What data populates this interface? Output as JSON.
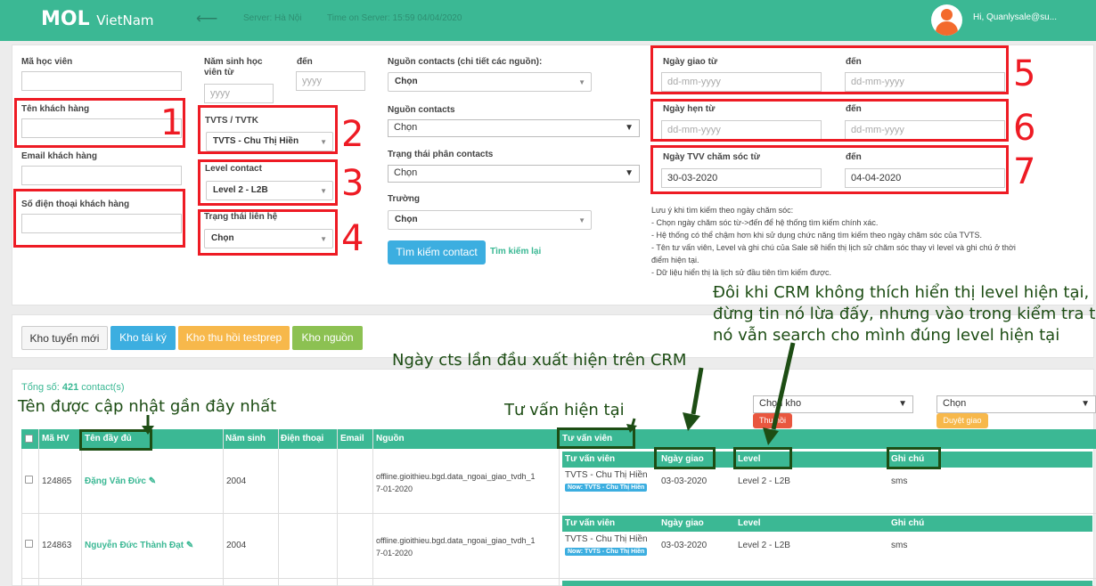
{
  "header": {
    "logo_main": "MOL",
    "logo_sub": "VietNam",
    "back_glyph": "⟵",
    "server": "Server: Hà Nội",
    "time": "Time on Server: 15:59 04/04/2020",
    "user": "Hi, Quanlysale@su..."
  },
  "filters": {
    "ma_hoc_vien": "Mã học viên",
    "ten_khach_hang": "Tên khách hàng",
    "email_khach_hang": "Email khách hàng",
    "so_dien_thoai": "Số điện thoại khách hàng",
    "nam_sinh_tu_line1": "Năm sinh học",
    "nam_sinh_tu_line2": "viên từ",
    "nam_sinh_den": "đến",
    "yyyy": "yyyy",
    "tvts_label": "TVTS / TVTK",
    "tvts_value": "TVTS - Chu Thị Hiền",
    "level_label": "Level contact",
    "level_value": "Level 2 - L2B",
    "trang_thai_lien_he": "Trạng thái liên hệ",
    "chon": "Chọn",
    "nguon_chi_tiet": "Nguồn contacts (chi tiết các nguồn):",
    "nguon_contacts": "Nguồn contacts",
    "trang_thai_phan": "Trạng thái phân contacts",
    "truong": "Trường",
    "search_button": "Tìm kiếm contact",
    "reset_link": "Tìm kiếm lại",
    "ngay_giao_tu": "Ngày giao từ",
    "ngay_hen_tu": "Ngày hẹn từ",
    "ngay_tvv_tu": "Ngày TVV chăm sóc từ",
    "den": "đến",
    "date_placeholder": "dd-mm-yyyy",
    "tvv_from": "30-03-2020",
    "tvv_to": "04-04-2020"
  },
  "notes": [
    "Lưu ý khi tìm kiếm theo ngày chăm sóc:",
    "- Chọn ngày chăm sóc từ->đến để hệ thống tìm kiếm chính xác.",
    "- Hệ thống có thể chậm hơn khi sử dụng chức năng tìm kiếm theo ngày chăm sóc của TVTS.",
    "- Tên tư vấn viên, Level và ghi chú của Sale sẽ hiển thị lịch sử chăm sóc thay vì level và ghi chú ở thời điểm hiện tại.",
    "- Dữ liệu hiển thị là lịch sử đầu tiên tìm kiếm được."
  ],
  "tabs": {
    "kho_tuyen_moi": "Kho tuyển mới",
    "kho_tai_ky": "Kho tái ký",
    "kho_thu_hoi": "Kho thu hồi testprep",
    "kho_nguon": "Kho nguồn"
  },
  "results": {
    "total_label": "Tổng số:",
    "total_count": "421",
    "total_unit": "contact(s)",
    "chon_kho": "Chọn kho",
    "chon": "Chọn",
    "thu_hoi": "Thu hồi",
    "duyet_giao": "Duyệt giao"
  },
  "table": {
    "headers": {
      "ma_hv": "Mã HV",
      "ten_day_du": "Tên đầy đủ",
      "nam_sinh": "Năm sinh",
      "dien_thoai": "Điện thoại",
      "email": "Email",
      "nguon": "Nguồn",
      "tu_van_vien": "Tư vấn viên"
    },
    "sub_headers": {
      "tu_van_vien": "Tư vấn viên",
      "ngay_giao": "Ngày giao",
      "level": "Level",
      "ghi_chu": "Ghi chú"
    },
    "rows": [
      {
        "ma_hv": "124865",
        "ten": "Đặng Văn Đức",
        "nam_sinh": "2004",
        "nguon_1": "offline.gioithieu.bgd.data_ngoai_giao_tvdh_1",
        "nguon_2": "7-01-2020",
        "tvv": "TVTS - Chu Thị Hiền",
        "now": "Now: TVTS - Chu Thị Hiền",
        "ngay_giao": "03-03-2020",
        "level": "Level 2 - L2B",
        "ghi_chu": "sms"
      },
      {
        "ma_hv": "124863",
        "ten": "Nguyễn Đức Thành Đạt",
        "nam_sinh": "2004",
        "nguon_1": "offline.gioithieu.bgd.data_ngoai_giao_tvdh_1",
        "nguon_2": "7-01-2020",
        "tvv": "TVTS - Chu Thị Hiền",
        "now": "Now: TVTS - Chu Thị Hiền",
        "ngay_giao": "03-03-2020",
        "level": "Level 2 - L2B",
        "ghi_chu": "sms"
      }
    ]
  },
  "annotations": {
    "numbers": [
      "1",
      "2",
      "3",
      "4",
      "5",
      "6",
      "7"
    ],
    "crm_line1": "Đôi khi CRM không thích hiển thị level hiện tại,",
    "crm_line2": "đừng tin nó lừa đấy, nhưng vào trong kiểm tra thì",
    "crm_line3": "nó vẫn search cho mình đúng level hiện tại",
    "ngay_cts": "Ngày cts lần đầu xuất hiện trên CRM",
    "ten_cap_nhat": "Tên được cập nhật gần đây nhất",
    "tu_van_hien_tai": "Tư vấn hiện tại"
  },
  "colors": {
    "brand_green": "#3bb894",
    "annotation_red": "#ee1b24",
    "annotation_green": "#1d4d14",
    "button_blue": "#3caee0",
    "button_orange": "#f7b84b",
    "button_olive": "#8cc152",
    "button_red": "#e9573f"
  },
  "icons": [
    "back-arrow-icon",
    "user-avatar-icon",
    "edit-icon",
    "dropdown-caret-icon",
    "checkbox-icon"
  ]
}
